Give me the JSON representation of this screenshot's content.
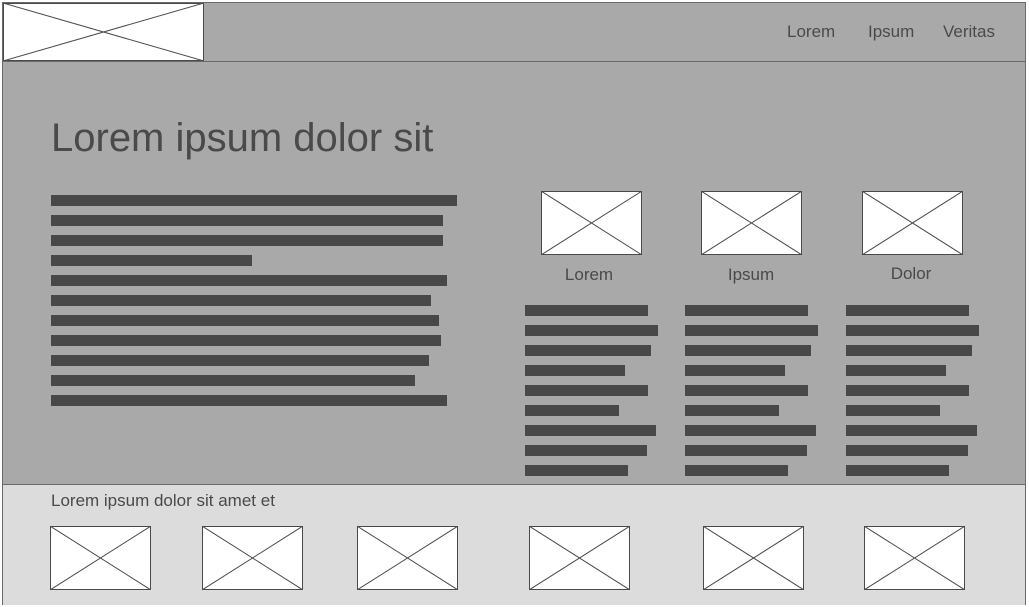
{
  "header": {
    "logo_icon": "image-placeholder-icon",
    "nav": [
      {
        "label": "Lorem"
      },
      {
        "label": "Ipsum"
      },
      {
        "label": "Veritas"
      }
    ]
  },
  "hero": {
    "title": "Lorem ipsum dolor sit"
  },
  "features": [
    {
      "icon": "image-placeholder-icon",
      "caption": "Lorem"
    },
    {
      "icon": "image-placeholder-icon",
      "caption": "Ipsum"
    },
    {
      "icon": "image-placeholder-icon",
      "caption": "Dolor"
    }
  ],
  "footer": {
    "text": "Lorem ipsum dolor sit amet et",
    "thumbnail_icon": "image-placeholder-icon",
    "thumbnail_count": 6
  },
  "colors": {
    "background": "#a9a9a9",
    "footer_background": "#dcdcdc",
    "text": "#4a4a4a",
    "text_bar": "#484848"
  }
}
